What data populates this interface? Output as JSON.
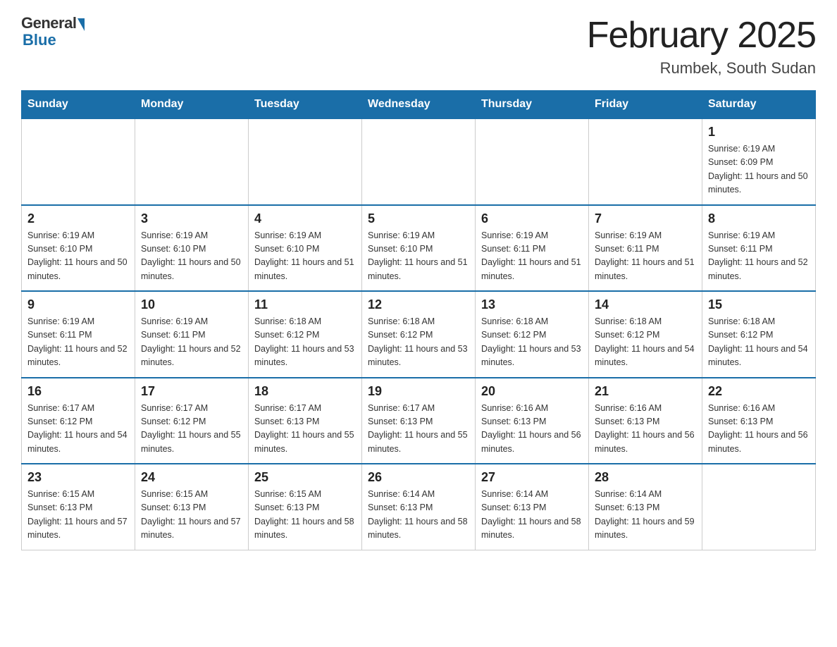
{
  "header": {
    "logo_general": "General",
    "logo_blue": "Blue",
    "month_title": "February 2025",
    "location": "Rumbek, South Sudan"
  },
  "days_of_week": [
    "Sunday",
    "Monday",
    "Tuesday",
    "Wednesday",
    "Thursday",
    "Friday",
    "Saturday"
  ],
  "weeks": [
    [
      {
        "day": "",
        "info": ""
      },
      {
        "day": "",
        "info": ""
      },
      {
        "day": "",
        "info": ""
      },
      {
        "day": "",
        "info": ""
      },
      {
        "day": "",
        "info": ""
      },
      {
        "day": "",
        "info": ""
      },
      {
        "day": "1",
        "info": "Sunrise: 6:19 AM\nSunset: 6:09 PM\nDaylight: 11 hours and 50 minutes."
      }
    ],
    [
      {
        "day": "2",
        "info": "Sunrise: 6:19 AM\nSunset: 6:10 PM\nDaylight: 11 hours and 50 minutes."
      },
      {
        "day": "3",
        "info": "Sunrise: 6:19 AM\nSunset: 6:10 PM\nDaylight: 11 hours and 50 minutes."
      },
      {
        "day": "4",
        "info": "Sunrise: 6:19 AM\nSunset: 6:10 PM\nDaylight: 11 hours and 51 minutes."
      },
      {
        "day": "5",
        "info": "Sunrise: 6:19 AM\nSunset: 6:10 PM\nDaylight: 11 hours and 51 minutes."
      },
      {
        "day": "6",
        "info": "Sunrise: 6:19 AM\nSunset: 6:11 PM\nDaylight: 11 hours and 51 minutes."
      },
      {
        "day": "7",
        "info": "Sunrise: 6:19 AM\nSunset: 6:11 PM\nDaylight: 11 hours and 51 minutes."
      },
      {
        "day": "8",
        "info": "Sunrise: 6:19 AM\nSunset: 6:11 PM\nDaylight: 11 hours and 52 minutes."
      }
    ],
    [
      {
        "day": "9",
        "info": "Sunrise: 6:19 AM\nSunset: 6:11 PM\nDaylight: 11 hours and 52 minutes."
      },
      {
        "day": "10",
        "info": "Sunrise: 6:19 AM\nSunset: 6:11 PM\nDaylight: 11 hours and 52 minutes."
      },
      {
        "day": "11",
        "info": "Sunrise: 6:18 AM\nSunset: 6:12 PM\nDaylight: 11 hours and 53 minutes."
      },
      {
        "day": "12",
        "info": "Sunrise: 6:18 AM\nSunset: 6:12 PM\nDaylight: 11 hours and 53 minutes."
      },
      {
        "day": "13",
        "info": "Sunrise: 6:18 AM\nSunset: 6:12 PM\nDaylight: 11 hours and 53 minutes."
      },
      {
        "day": "14",
        "info": "Sunrise: 6:18 AM\nSunset: 6:12 PM\nDaylight: 11 hours and 54 minutes."
      },
      {
        "day": "15",
        "info": "Sunrise: 6:18 AM\nSunset: 6:12 PM\nDaylight: 11 hours and 54 minutes."
      }
    ],
    [
      {
        "day": "16",
        "info": "Sunrise: 6:17 AM\nSunset: 6:12 PM\nDaylight: 11 hours and 54 minutes."
      },
      {
        "day": "17",
        "info": "Sunrise: 6:17 AM\nSunset: 6:12 PM\nDaylight: 11 hours and 55 minutes."
      },
      {
        "day": "18",
        "info": "Sunrise: 6:17 AM\nSunset: 6:13 PM\nDaylight: 11 hours and 55 minutes."
      },
      {
        "day": "19",
        "info": "Sunrise: 6:17 AM\nSunset: 6:13 PM\nDaylight: 11 hours and 55 minutes."
      },
      {
        "day": "20",
        "info": "Sunrise: 6:16 AM\nSunset: 6:13 PM\nDaylight: 11 hours and 56 minutes."
      },
      {
        "day": "21",
        "info": "Sunrise: 6:16 AM\nSunset: 6:13 PM\nDaylight: 11 hours and 56 minutes."
      },
      {
        "day": "22",
        "info": "Sunrise: 6:16 AM\nSunset: 6:13 PM\nDaylight: 11 hours and 56 minutes."
      }
    ],
    [
      {
        "day": "23",
        "info": "Sunrise: 6:15 AM\nSunset: 6:13 PM\nDaylight: 11 hours and 57 minutes."
      },
      {
        "day": "24",
        "info": "Sunrise: 6:15 AM\nSunset: 6:13 PM\nDaylight: 11 hours and 57 minutes."
      },
      {
        "day": "25",
        "info": "Sunrise: 6:15 AM\nSunset: 6:13 PM\nDaylight: 11 hours and 58 minutes."
      },
      {
        "day": "26",
        "info": "Sunrise: 6:14 AM\nSunset: 6:13 PM\nDaylight: 11 hours and 58 minutes."
      },
      {
        "day": "27",
        "info": "Sunrise: 6:14 AM\nSunset: 6:13 PM\nDaylight: 11 hours and 58 minutes."
      },
      {
        "day": "28",
        "info": "Sunrise: 6:14 AM\nSunset: 6:13 PM\nDaylight: 11 hours and 59 minutes."
      },
      {
        "day": "",
        "info": ""
      }
    ]
  ]
}
